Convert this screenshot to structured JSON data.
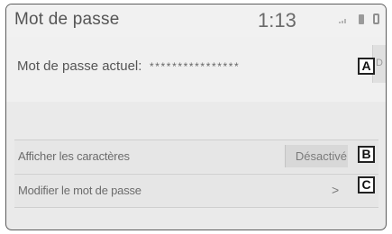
{
  "header": {
    "title": "Mot de passe",
    "clock": "1:13"
  },
  "password": {
    "label": "Mot de passe actuel:",
    "value": "****************"
  },
  "options": {
    "show_chars": {
      "label": "Afficher les caractères",
      "status": "Désactivé"
    },
    "change_password": {
      "label": "Modifier le mot de passe",
      "chevron": ">"
    }
  },
  "callouts": {
    "a": "A",
    "b": "B",
    "c": "C"
  },
  "icons": {
    "status": [
      "signal-icon",
      "phone-icon",
      "battery-icon"
    ],
    "side_button": "D"
  }
}
